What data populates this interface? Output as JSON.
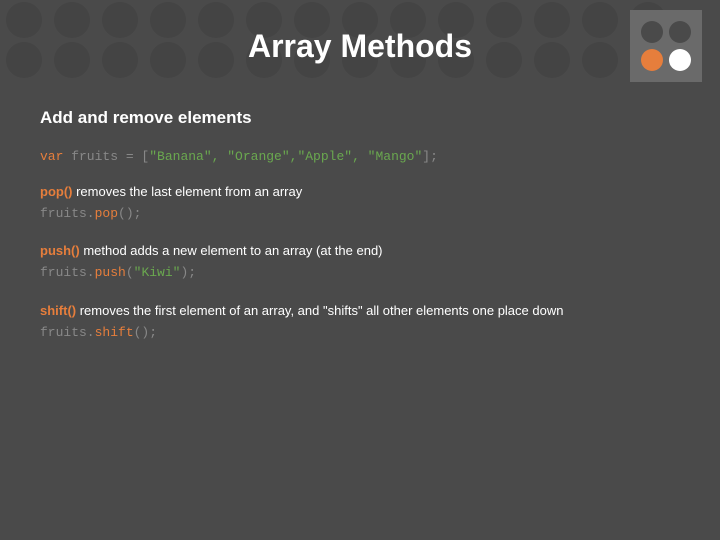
{
  "title": "Array Methods",
  "subtitle": "Add and remove elements",
  "declaration": {
    "var": "var",
    "name": " fruits = [",
    "items": "\"Banana\", \"Orange\",\"Apple\", \"Mango\"",
    "close": "];"
  },
  "sections": [
    {
      "method": "pop()",
      "desc": " removes the last element from an array",
      "code_pre": "fruits.",
      "code_call": "pop",
      "code_args": "();"
    },
    {
      "method": "push()",
      "desc": " method adds a new element to an array (at the end)",
      "code_pre": "fruits.",
      "code_call": "push",
      "code_args_open": "(",
      "code_args_str": "\"Kiwi\"",
      "code_args_close": ");"
    },
    {
      "method": "shift()",
      "desc": " removes the first element of an array, and \"shifts\" all other elements one place down",
      "code_pre": "fruits.",
      "code_call": "shift",
      "code_args": "();"
    }
  ]
}
